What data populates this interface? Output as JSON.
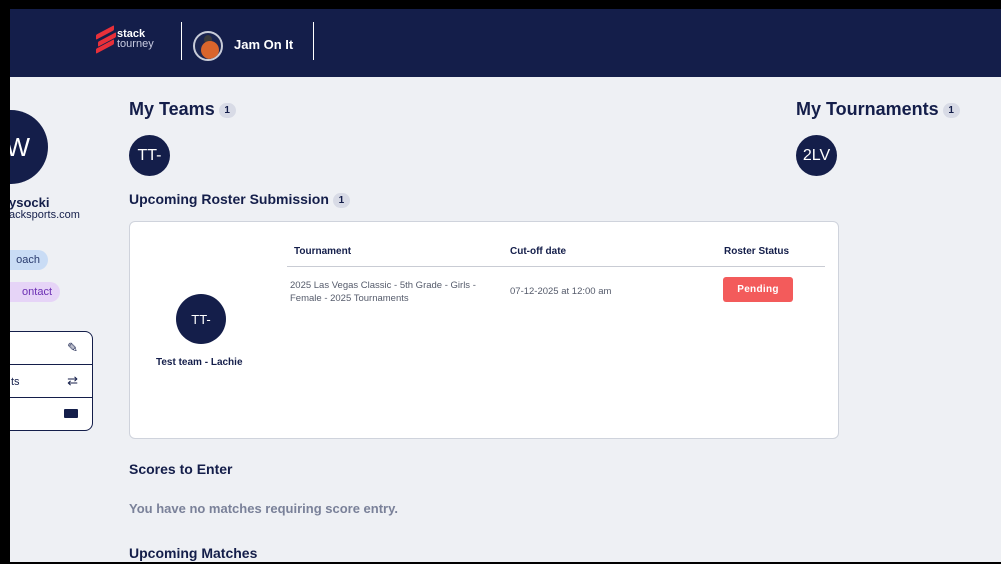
{
  "header": {
    "logo_line1": "stack",
    "logo_line2": "tourney",
    "org_name": "Jam On It"
  },
  "profile": {
    "initials": "W",
    "name": "ysocki",
    "email": "acksports.com",
    "role": "oach",
    "contact": "ontact",
    "menu": [
      {
        "label": "",
        "icon": "edit-icon"
      },
      {
        "label": "ts",
        "icon": "transfer-icon"
      },
      {
        "label": "",
        "icon": "credit-card-icon"
      }
    ]
  },
  "my_teams": {
    "title": "My Teams",
    "count": "1",
    "team_initials": "TT-"
  },
  "my_tournaments": {
    "title": "My Tournaments",
    "count": "1",
    "tournament_initials": "2LV"
  },
  "roster_submission": {
    "title": "Upcoming Roster Submission",
    "count": "1",
    "team_initials": "TT-",
    "team_name": "Test team - Lachie",
    "columns": [
      "Tournament",
      "Cut-off date",
      "Roster Status"
    ],
    "rows": [
      {
        "tournament": "2025 Las Vegas Classic - 5th Grade - Girls - Female - 2025 Tournaments",
        "cutoff": "07-12-2025 at 12:00 am",
        "status": "Pending"
      }
    ]
  },
  "scores": {
    "title": "Scores to Enter",
    "empty_message": "You have no matches requiring score entry."
  },
  "upcoming_matches": {
    "title": "Upcoming Matches"
  },
  "colors": {
    "navy": "#141e4a",
    "pending": "#f35b5b",
    "brand_red": "#e8303a"
  }
}
